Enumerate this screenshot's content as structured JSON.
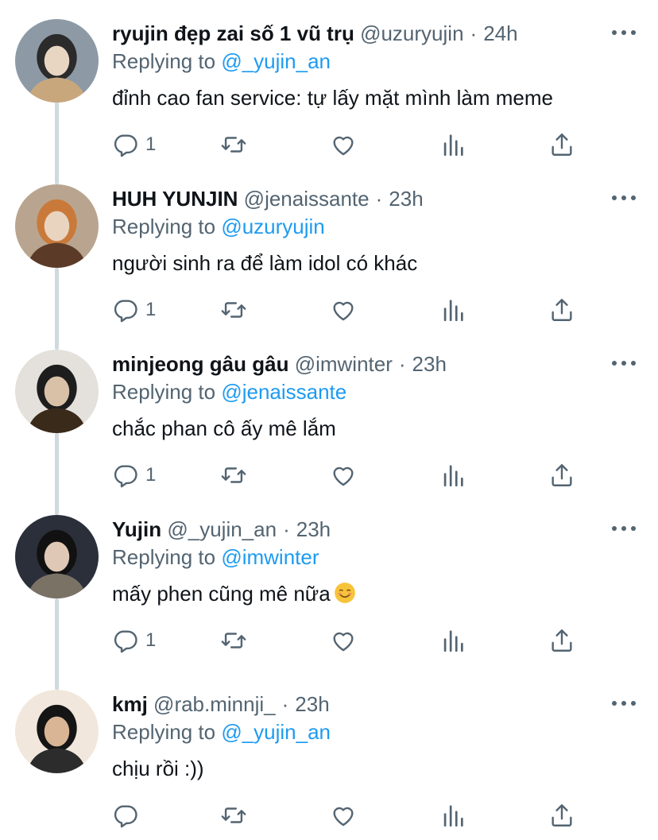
{
  "tweets": [
    {
      "name": "ryujin đẹp zai số 1 vũ trụ",
      "handle": "@uzuryujin",
      "time": "24h",
      "replying_label": "Replying to",
      "replying_to": "@_yujin_an",
      "text": "đỉnh cao fan service: tự lấy mặt mình làm meme",
      "reply_count": "1"
    },
    {
      "name": "HUH YUNJIN",
      "handle": "@jenaissante",
      "time": "23h",
      "replying_label": "Replying to",
      "replying_to": "@uzuryujin",
      "text": "người sinh ra để làm idol có khác",
      "reply_count": "1"
    },
    {
      "name": "minjeong gâu gâu",
      "handle": "@imwinter",
      "time": "23h",
      "replying_label": "Replying to",
      "replying_to": "@jenaissante",
      "text": "chắc phan cô ấy mê lắm",
      "reply_count": "1"
    },
    {
      "name": "Yujin",
      "handle": "@_yujin_an",
      "time": "23h",
      "replying_label": "Replying to",
      "replying_to": "@imwinter",
      "text": "mấy phen cũng mê nữa",
      "reply_count": "1"
    },
    {
      "name": "kmj",
      "handle": "@rab.minnji_",
      "time": "23h",
      "replying_label": "Replying to",
      "replying_to": "@_yujin_an",
      "text": "chịu rồi :))",
      "reply_count": ""
    }
  ],
  "separator": "·",
  "colors": {
    "text": "#0f1419",
    "secondary": "#536471",
    "link": "#1d9bf0",
    "thread_line": "#cfd9de"
  },
  "icons": [
    "reply-icon",
    "retweet-icon",
    "like-icon",
    "views-icon",
    "share-icon",
    "more-icon",
    "smiling-face-emoji-icon"
  ]
}
